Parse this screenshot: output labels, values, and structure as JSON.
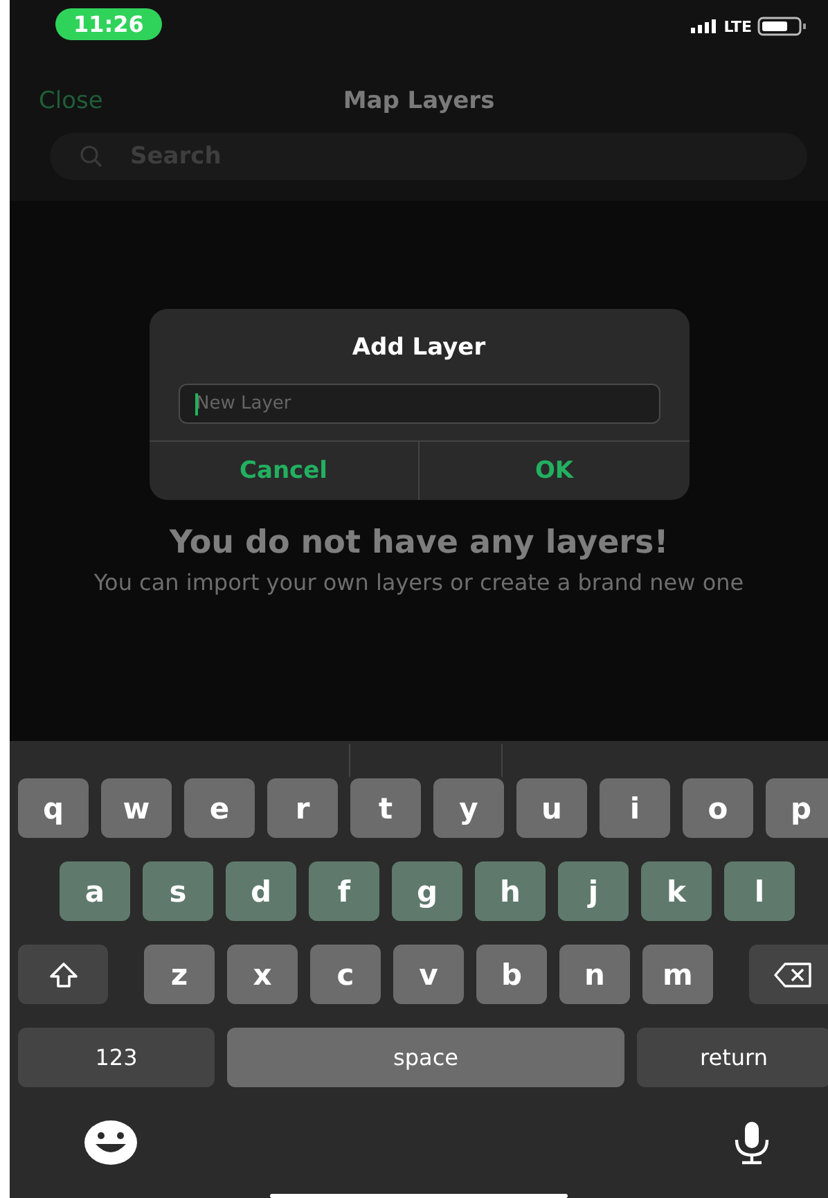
{
  "status_bar": {
    "time": "11:26",
    "network": "LTE"
  },
  "nav": {
    "close": "Close",
    "title": "Map Layers"
  },
  "search": {
    "placeholder": "Search"
  },
  "empty_state": {
    "title": "You do not have any layers!",
    "text": "You can import your own layers or create a brand new one"
  },
  "dialog": {
    "title": "Add Layer",
    "field": {
      "placeholder": "New Layer"
    },
    "buttons": [
      "Cancel",
      "OK"
    ]
  },
  "keyboard": {
    "rows": [
      {
        "keys": [
          {
            "kind": "letter",
            "label": "q"
          },
          {
            "kind": "letter",
            "label": "w"
          },
          {
            "kind": "letter",
            "label": "e"
          },
          {
            "kind": "letter",
            "label": "r"
          },
          {
            "kind": "letter",
            "label": "t"
          },
          {
            "kind": "letter",
            "label": "y"
          },
          {
            "kind": "letter",
            "label": "u"
          },
          {
            "kind": "letter",
            "label": "i"
          },
          {
            "kind": "letter",
            "label": "o"
          },
          {
            "kind": "letter",
            "label": "p"
          }
        ]
      },
      {
        "keys": [
          {
            "kind": "letter",
            "label": "a"
          },
          {
            "kind": "letter",
            "label": "s"
          },
          {
            "kind": "letter",
            "label": "d"
          },
          {
            "kind": "letter",
            "label": "f"
          },
          {
            "kind": "letter",
            "label": "g"
          },
          {
            "kind": "letter",
            "label": "h"
          },
          {
            "kind": "letter",
            "label": "j"
          },
          {
            "kind": "letter",
            "label": "k"
          },
          {
            "kind": "letter",
            "label": "l"
          }
        ]
      },
      {
        "keys": [
          {
            "kind": "shift"
          },
          {
            "kind": "letter",
            "label": "z"
          },
          {
            "kind": "letter",
            "label": "x"
          },
          {
            "kind": "letter",
            "label": "c"
          },
          {
            "kind": "letter",
            "label": "v"
          },
          {
            "kind": "letter",
            "label": "b"
          },
          {
            "kind": "letter",
            "label": "n"
          },
          {
            "kind": "letter",
            "label": "m"
          },
          {
            "kind": "delete"
          }
        ]
      },
      {
        "keys": [
          {
            "kind": "mode",
            "label": "123"
          },
          {
            "kind": "space",
            "label": "space"
          },
          {
            "kind": "return",
            "label": "return"
          }
        ]
      }
    ]
  }
}
